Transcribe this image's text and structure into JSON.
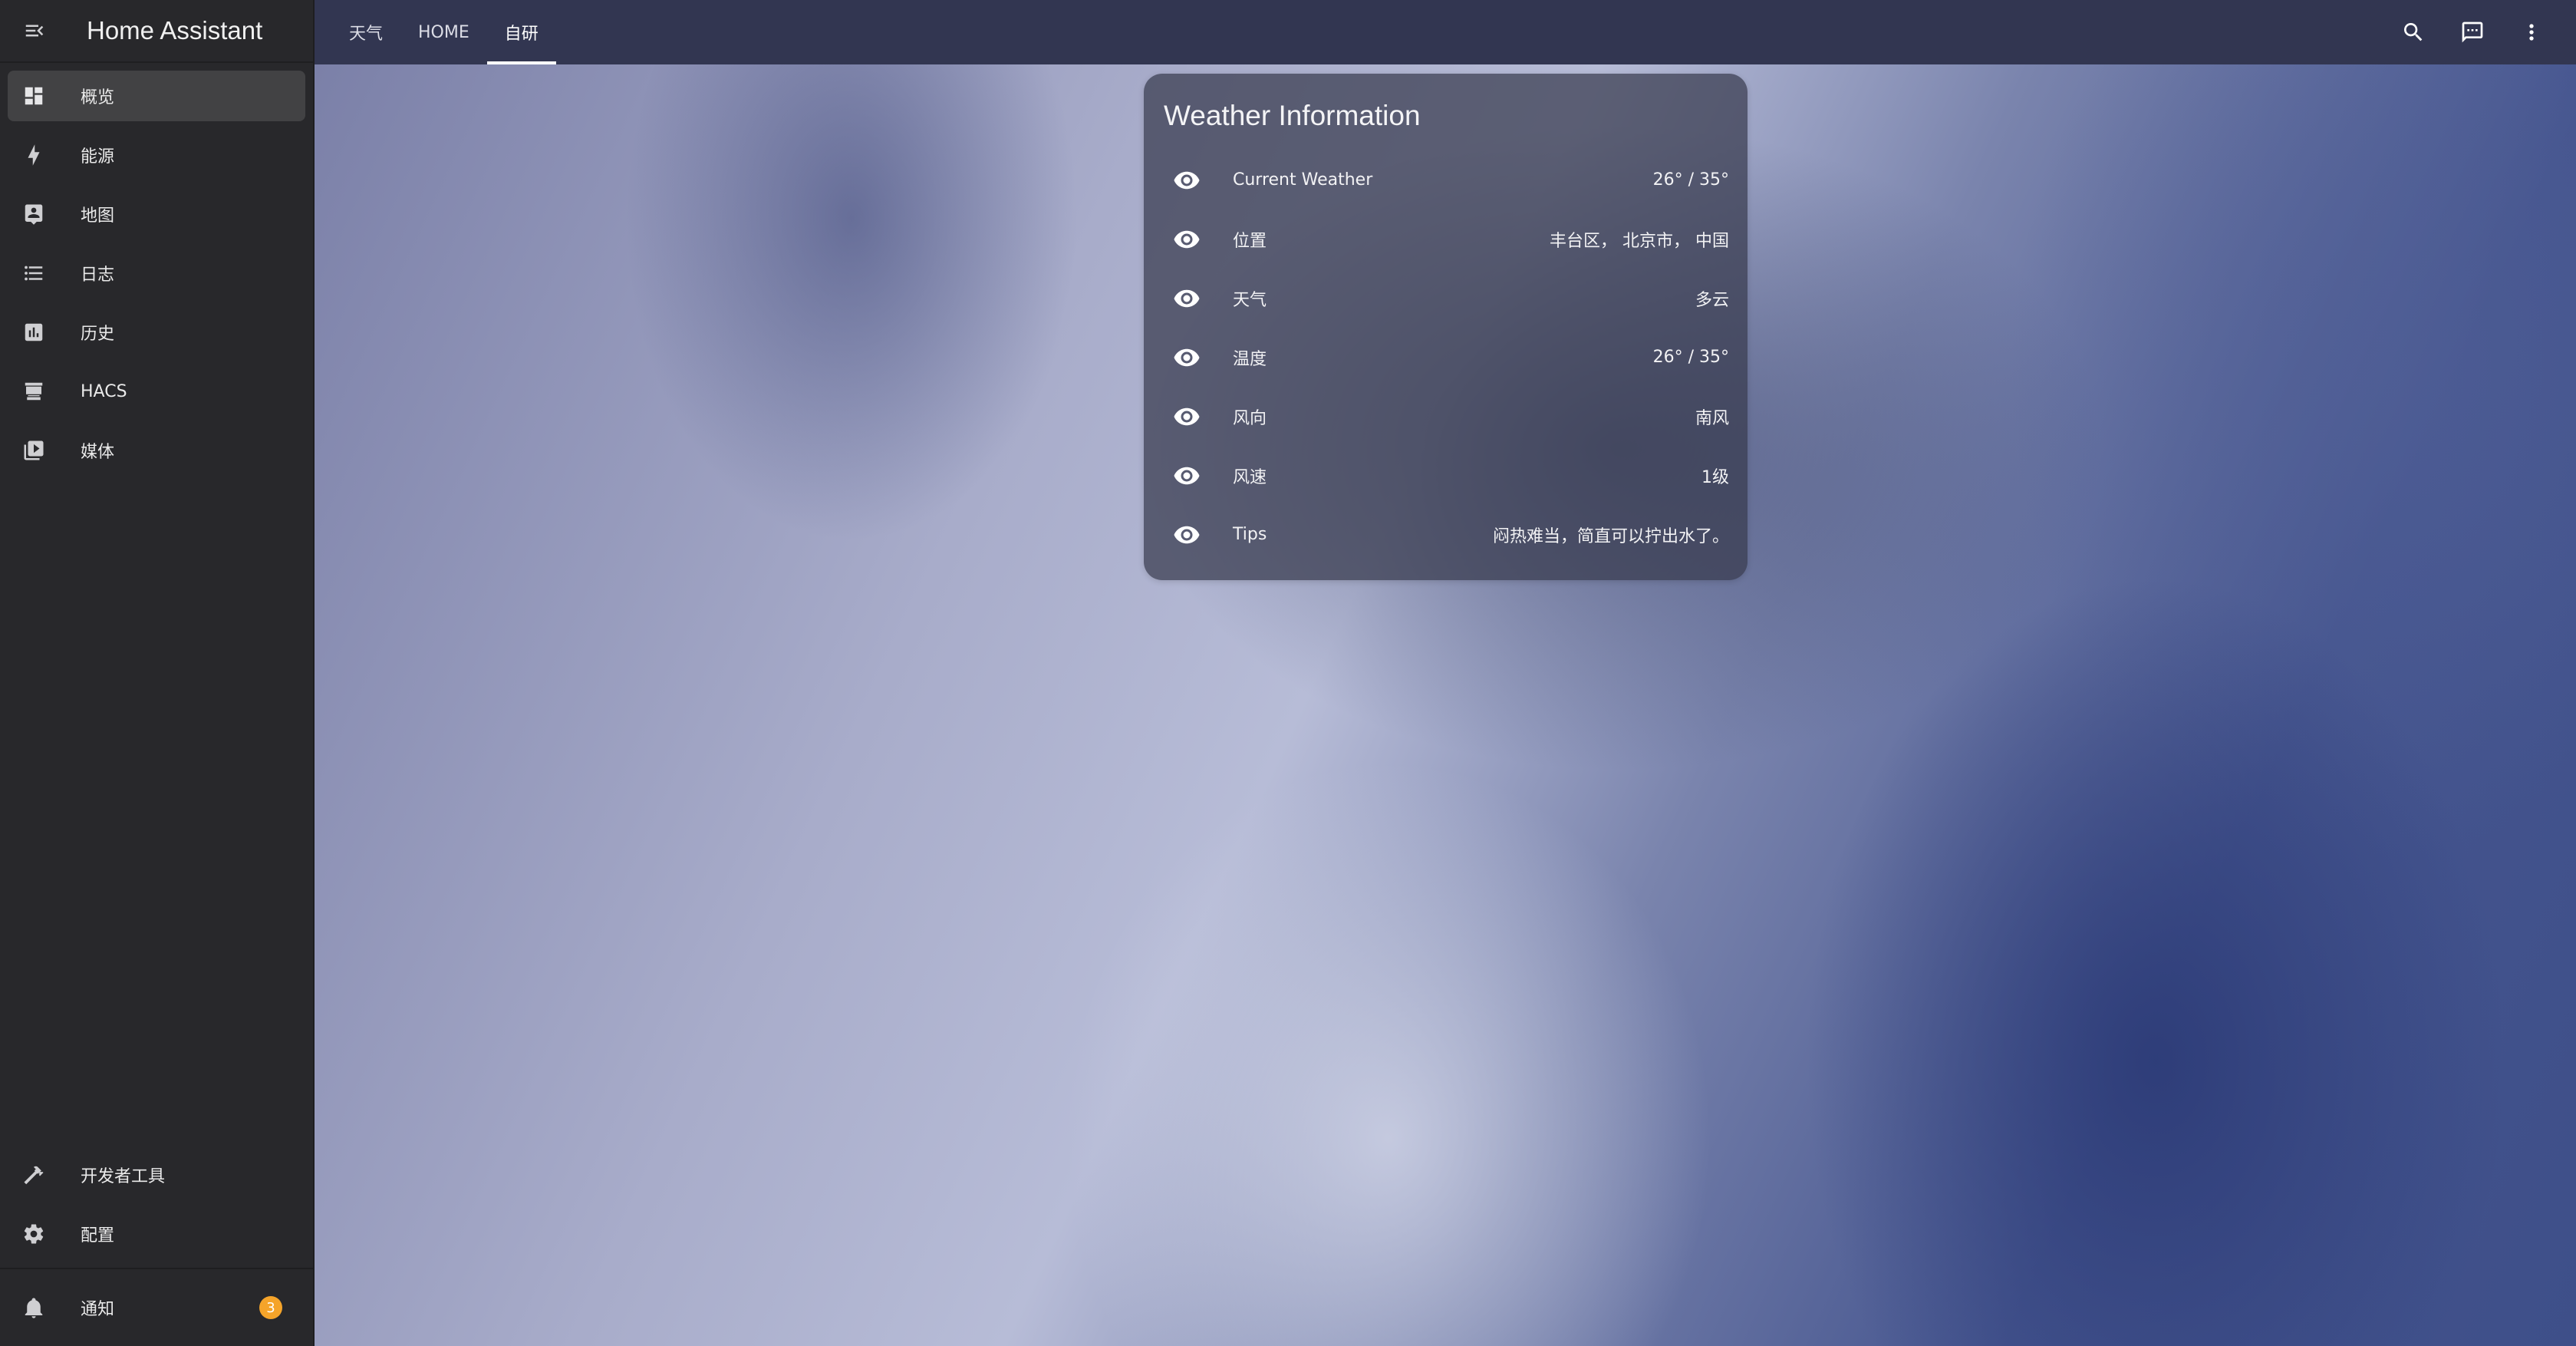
{
  "app": {
    "title": "Home Assistant"
  },
  "sidebar": {
    "items": [
      {
        "label": "概览",
        "icon": "dashboard-icon",
        "active": true
      },
      {
        "label": "能源",
        "icon": "lightning-icon"
      },
      {
        "label": "地图",
        "icon": "map-account-icon"
      },
      {
        "label": "日志",
        "icon": "list-icon"
      },
      {
        "label": "历史",
        "icon": "chart-box-icon"
      },
      {
        "label": "HACS",
        "icon": "hacs-icon"
      },
      {
        "label": "媒体",
        "icon": "media-play-icon"
      }
    ],
    "bottom_items": [
      {
        "label": "开发者工具",
        "icon": "hammer-icon"
      },
      {
        "label": "配置",
        "icon": "gear-icon"
      }
    ],
    "notifications": {
      "label": "通知",
      "icon": "bell-icon",
      "count": "3"
    }
  },
  "topbar": {
    "tabs": [
      {
        "label": "天气"
      },
      {
        "label": "HOME"
      },
      {
        "label": "自研",
        "active": true
      }
    ],
    "actions": [
      "search-icon",
      "message-text-icon",
      "dots-vertical-icon"
    ]
  },
  "card": {
    "title": "Weather Information",
    "rows": [
      {
        "name": "Current Weather",
        "value": "26° / 35°",
        "icon": "eye-icon"
      },
      {
        "name": "位置",
        "value": "丰台区， 北京市， 中国",
        "icon": "eye-icon"
      },
      {
        "name": "天气",
        "value": "多云",
        "icon": "eye-icon"
      },
      {
        "name": "温度",
        "value": "26° / 35°",
        "icon": "eye-icon"
      },
      {
        "name": "风向",
        "value": "南风",
        "icon": "eye-icon"
      },
      {
        "name": "风速",
        "value": "1级",
        "icon": "eye-icon"
      },
      {
        "name": "Tips",
        "value": "闷热难当，简直可以拧出水了。",
        "icon": "eye-icon"
      }
    ]
  },
  "colors": {
    "sidebar_bg": "#28282b",
    "topbar_bg": "#323651",
    "badge": "#f5a42a",
    "card_bg": "rgba(55,58,78,0.72)"
  }
}
